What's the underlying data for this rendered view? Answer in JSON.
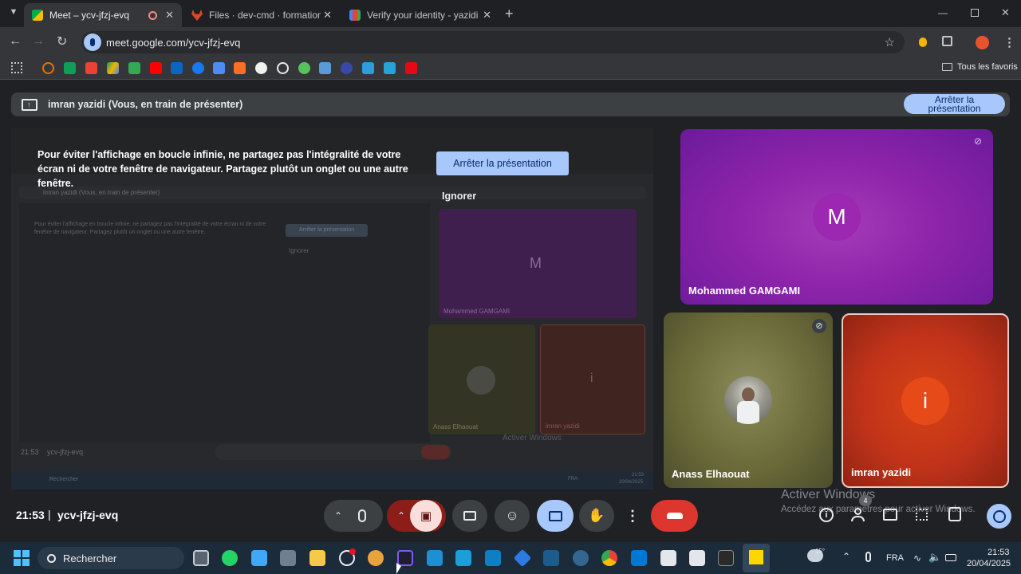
{
  "tabs": [
    {
      "title": "Meet – ycv-jfzj-evq",
      "active": true
    },
    {
      "title": "Files · dev-cmd · formations / m",
      "active": false
    },
    {
      "title": "Verify your identity - yazidi.imr",
      "active": false
    }
  ],
  "toolbar": {
    "url": "meet.google.com/ycv-jfzj-evq",
    "bookmarks_all": "Tous les favoris"
  },
  "banner": {
    "presenter_text": "imran yazidi (Vous, en train de présenter)",
    "stop_button": "Arrêter la présentation"
  },
  "warning": {
    "text": "Pour éviter l'affichage en boucle infinie, ne partagez pas l'intégralité de votre écran ni de votre fenêtre de navigateur. Partagez plutôt un onglet ou une autre fenêtre.",
    "stop_button": "Arrêter la présentation",
    "ignore_button": "Ignorer"
  },
  "mirror": {
    "banner_text": "imran yazidi (Vous, en train de présenter)",
    "warning_text": "Pour éviter l'affichage en boucle infinie, ne partagez pas l'intégralité de votre écran ni de votre fenêtre de navigateur. Partagez plutôt un onglet ou une autre fenêtre.",
    "stop_button": "Arrêter la présentation",
    "ignore_button": "Ignorer",
    "tile1_name": "Mohammed GAMGAMI",
    "tile1_initial": "M",
    "tile2_name": "Anass Elhaouat",
    "tile3_name": "imran yazidi",
    "tile3_initial": "i",
    "time": "21:53",
    "code": "ycv-jfzj-evq",
    "search": "Rechercher",
    "activate": "Activer Windows",
    "lang": "FRA",
    "clock_time": "21:53",
    "clock_date": "20/04/2025"
  },
  "participants": [
    {
      "name": "Mohammed GAMGAMI",
      "initial": "M",
      "muted": true,
      "color": "#8e24aa"
    },
    {
      "name": "Anass Elhaouat",
      "initial": "",
      "muted": true,
      "color": "#6b6b3a"
    },
    {
      "name": "imran yazidi",
      "initial": "i",
      "muted": false,
      "color": "#c0331a"
    }
  ],
  "meeting": {
    "time": "21:53",
    "separator": "|",
    "code": "ycv-jfzj-evq",
    "participants_count": "4"
  },
  "activation": {
    "title": "Activer Windows",
    "subtitle": "Accédez aux paramètres pour activer Windows."
  },
  "taskbar": {
    "search": "Rechercher",
    "temperature": "15°",
    "lang": "FRA",
    "time": "21:53",
    "date": "20/04/2025"
  }
}
